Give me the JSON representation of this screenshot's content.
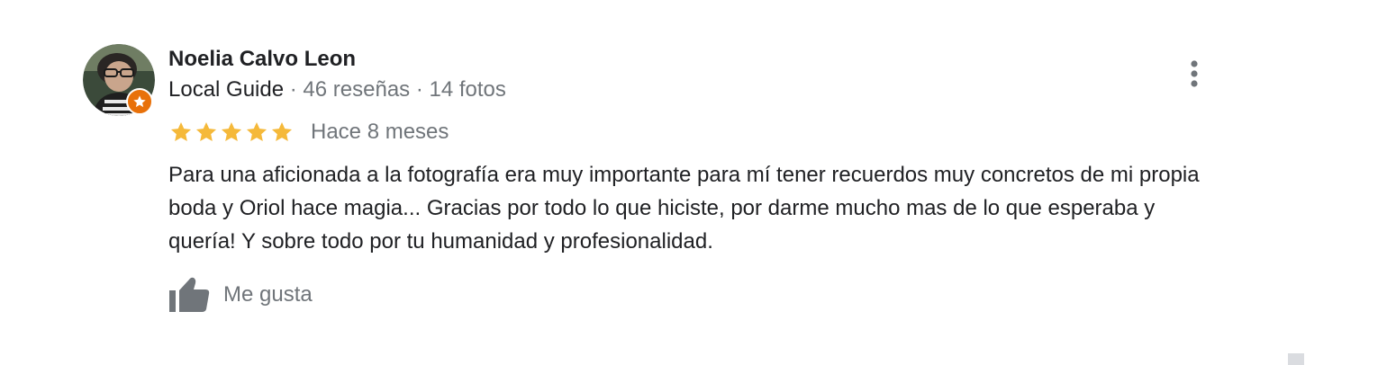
{
  "review": {
    "author": {
      "name": "Noelia Calvo Leon",
      "guide_label": "Local Guide",
      "meta": " · 46 reseñas · 14 fotos",
      "avatar_icon": "user-photo",
      "badge_icon": "local-guide-star-icon"
    },
    "rating": {
      "stars": 5,
      "max": 5,
      "star_color": "#fbbc04"
    },
    "date": "Hace 8 meses",
    "text": "Para una aficionada a la fotografía era muy importante para mí tener recuerdos muy concretos de mi propia boda y Oriol hace magia... Gracias por todo lo que hiciste, por darme mucho mas de lo que esperaba y quería! Y sobre todo por tu humanidad y profesionalidad.",
    "actions": {
      "like_label": "Me gusta",
      "like_icon": "thumbs-up-icon",
      "more_icon": "more-vert-icon"
    }
  },
  "colors": {
    "primary_text": "#202124",
    "secondary_text": "#70757a",
    "badge": "#e8710a"
  }
}
